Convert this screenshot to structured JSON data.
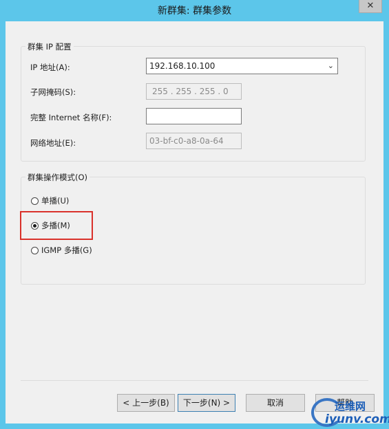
{
  "window": {
    "title": "新群集: 群集参数",
    "close_label": "✕"
  },
  "ip_config": {
    "legend": "群集 IP 配置",
    "ip_label": "IP 地址(A):",
    "ip_value": "192.168.10.100",
    "subnet_label": "子网掩码(S):",
    "subnet_value": "255 . 255 . 255 .  0",
    "fqdn_label": "完整 Internet 名称(F):",
    "fqdn_value": "",
    "mac_label": "网络地址(E):",
    "mac_value": "03-bf-c0-a8-0a-64"
  },
  "mode": {
    "legend": "群集操作模式(O)",
    "options": [
      {
        "label": "单播(U)",
        "checked": false
      },
      {
        "label": "多播(M)",
        "checked": true
      },
      {
        "label": "IGMP 多播(G)",
        "checked": false
      }
    ]
  },
  "buttons": {
    "back": "< 上一步(B)",
    "next": "下一步(N) >",
    "cancel": "取消",
    "help": "帮助"
  },
  "watermark": {
    "line1": "运维网",
    "line2": "iyunv.com"
  }
}
